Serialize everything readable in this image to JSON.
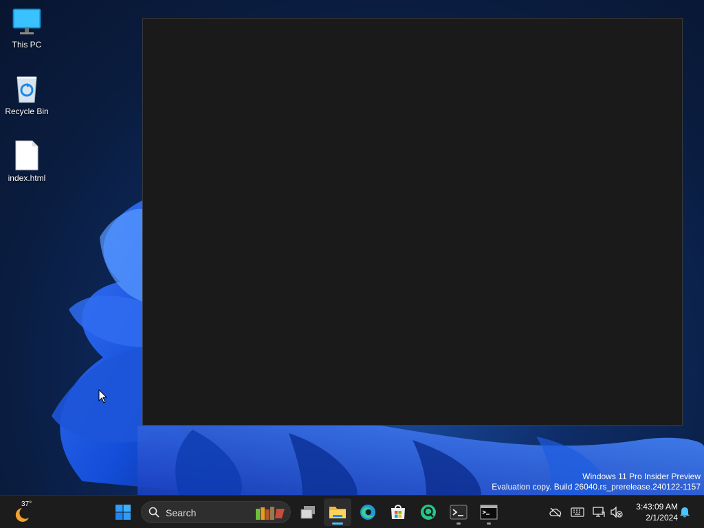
{
  "desktop": {
    "icons": [
      {
        "label": "This PC",
        "icon": "this-pc-icon"
      },
      {
        "label": "Recycle Bin",
        "icon": "recycle-bin-icon"
      },
      {
        "label": "index.html",
        "icon": "html-file-icon"
      }
    ]
  },
  "watermark": {
    "line1": "Windows 11 Pro Insider Preview",
    "line2": "Evaluation copy. Build 26040.rs_prerelease.240122-1157"
  },
  "taskbar": {
    "weather": {
      "temp": "37°",
      "icon": "weather-moon-icon"
    },
    "start_icon": "windows-start-icon",
    "search": {
      "placeholder": "Search"
    },
    "pinned": [
      {
        "name": "task-view",
        "icon": "task-view-icon"
      },
      {
        "name": "file-explorer",
        "icon": "folder-icon",
        "active": true
      },
      {
        "name": "edge",
        "icon": "edge-icon"
      },
      {
        "name": "store",
        "icon": "store-icon"
      },
      {
        "name": "app-q",
        "icon": "q-app-icon"
      },
      {
        "name": "terminal",
        "icon": "terminal-icon",
        "running": true
      },
      {
        "name": "command-prompt",
        "icon": "cmd-icon",
        "running": true
      }
    ],
    "tray": [
      "cloud-offline-icon",
      "keyboard-icon",
      "network-icon",
      "volume-muted-icon"
    ],
    "clock": {
      "time": "3:43:09 AM",
      "date": "2/1/2024"
    },
    "notification_icon": "bell-icon"
  },
  "colors": {
    "accent": "#4cc2ff",
    "taskbar": "#1c1c1c",
    "window": "#1a1a1a"
  }
}
